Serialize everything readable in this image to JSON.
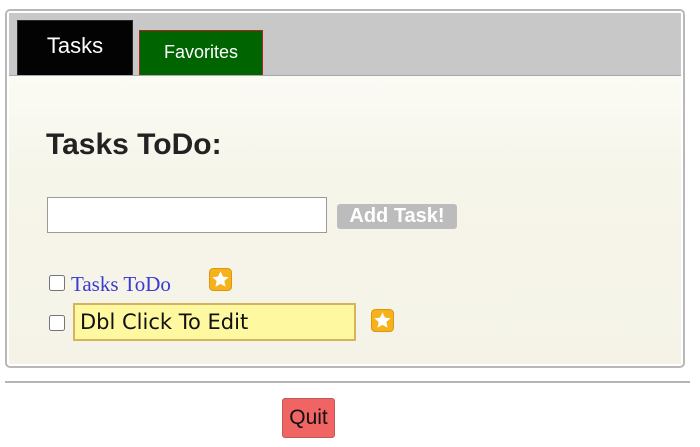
{
  "tabs": [
    {
      "label": "Tasks",
      "active": true
    },
    {
      "label": "Favorites",
      "active": false
    }
  ],
  "tasks_panel": {
    "title": "Tasks ToDo:",
    "new_task_input": {
      "value": "",
      "placeholder": ""
    },
    "add_button_label": "Add Task!",
    "items": [
      {
        "text": "Tasks ToDo",
        "checked": false,
        "icon": "star-favorite-icon"
      },
      {
        "text": "Dbl Click To Edit",
        "checked": false,
        "icon": "star-favorite-icon"
      }
    ]
  },
  "footer": {
    "quit_label": "Quit"
  },
  "colors": {
    "tasks_tab": "#030303",
    "favorites_tab": "#006400",
    "panel_bg": "#f5f3e7",
    "edit_highlight": "#fef8a0",
    "add_button": "#bcbcbc",
    "quit_button": "#f06464",
    "star": "#f6b21a",
    "link": "#3a3ad4"
  }
}
